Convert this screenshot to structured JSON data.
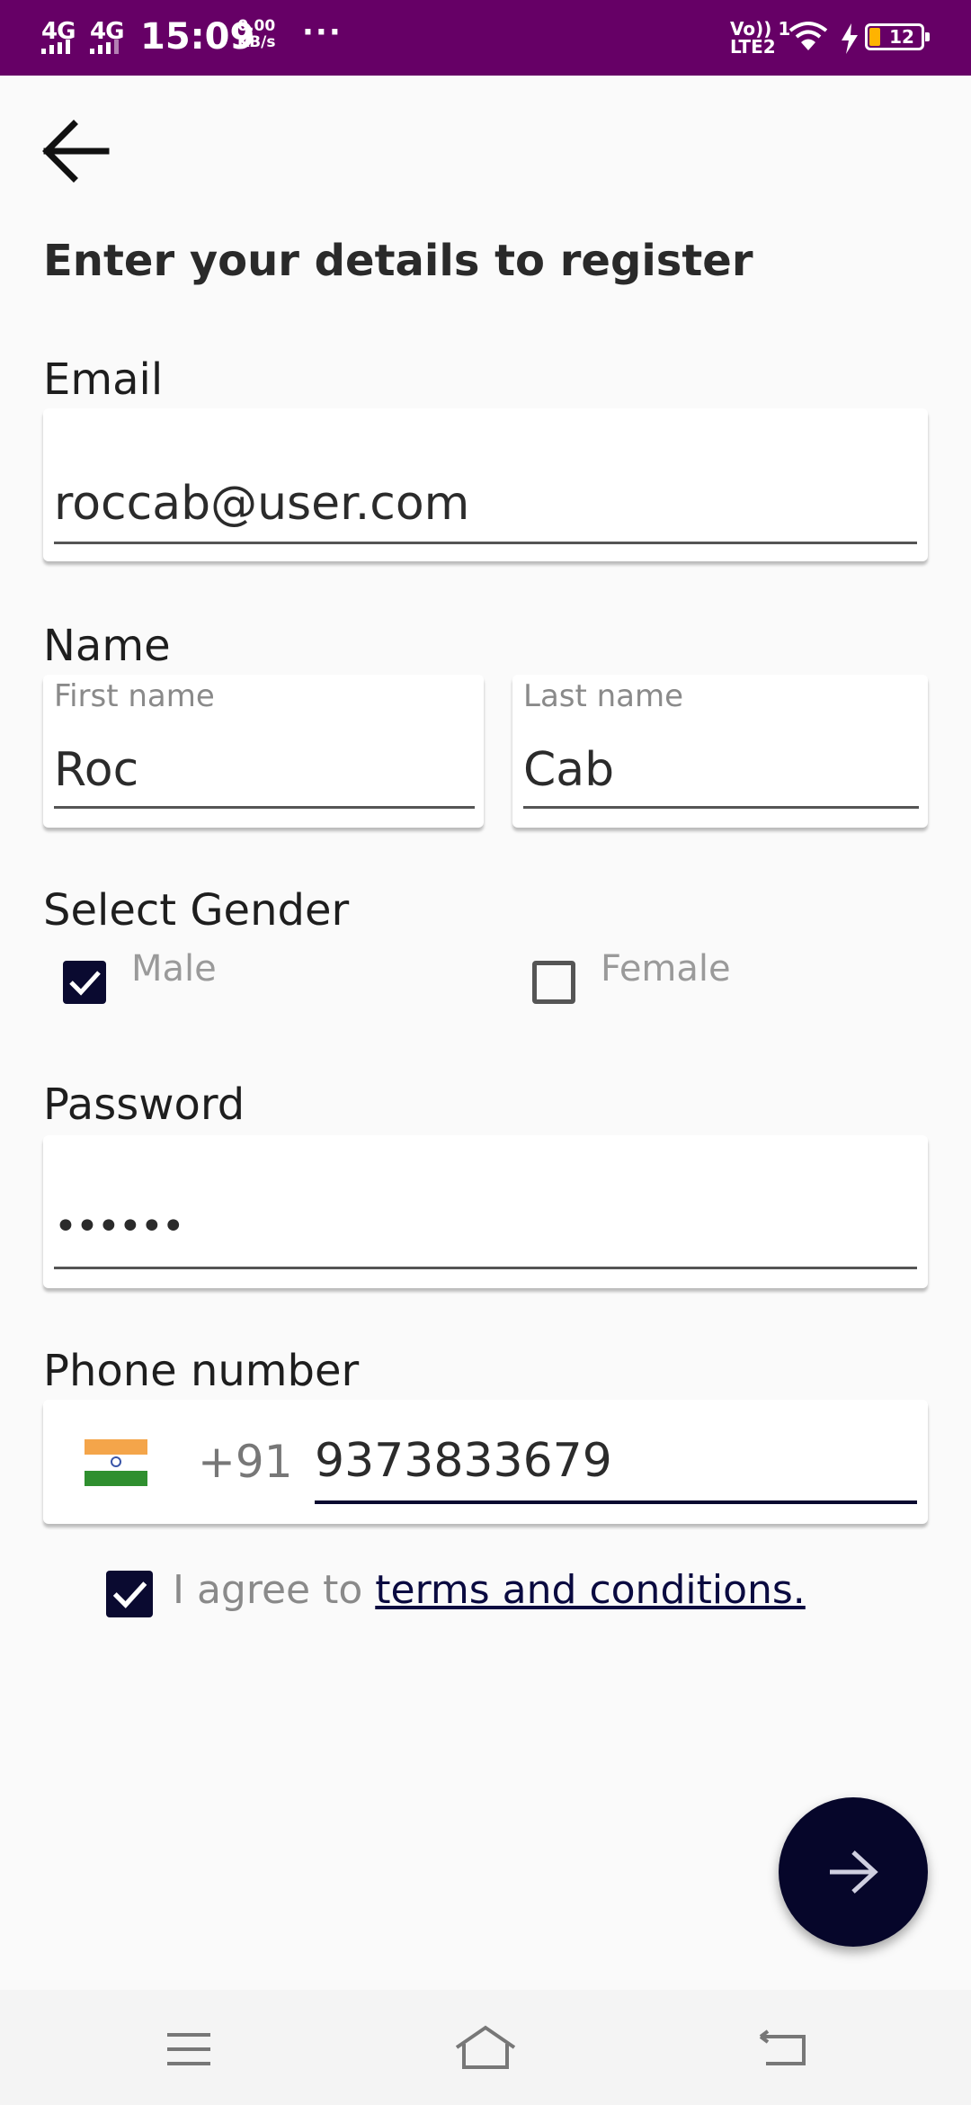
{
  "status_bar": {
    "network_1": "4G",
    "network_2": "4G",
    "time": "15:09",
    "speed_value": "0.00",
    "speed_unit": "KB/s",
    "overflow": "···",
    "volte_line1": "Vo)) 1",
    "volte_line2": "LTE2",
    "battery": "12",
    "battery_level_percent": 12
  },
  "header": {
    "title": "Enter your details to register"
  },
  "email": {
    "label": "Email",
    "value": "roccab@user.com"
  },
  "name": {
    "label": "Name",
    "first_hint": "First name",
    "first_value": "Roc",
    "last_hint": "Last name",
    "last_value": "Cab"
  },
  "gender": {
    "label": "Select Gender",
    "options": [
      {
        "label": "Male",
        "checked": true
      },
      {
        "label": "Female",
        "checked": false
      }
    ]
  },
  "password": {
    "label": "Password",
    "value": "••••••"
  },
  "phone": {
    "label": "Phone number",
    "dial_code": "+91",
    "value": "9373833679"
  },
  "terms": {
    "prefix": "I agree to ",
    "link": "terms and conditions.",
    "checked": true
  },
  "icons": {
    "back": "arrow-left-icon",
    "next": "arrow-right-icon",
    "nav_menu": "menu-icon",
    "nav_home": "home-icon",
    "nav_back": "return-icon"
  },
  "colors": {
    "status_bar": "#660066",
    "accent_dark": "#0a0a30",
    "background": "#fafafa"
  }
}
